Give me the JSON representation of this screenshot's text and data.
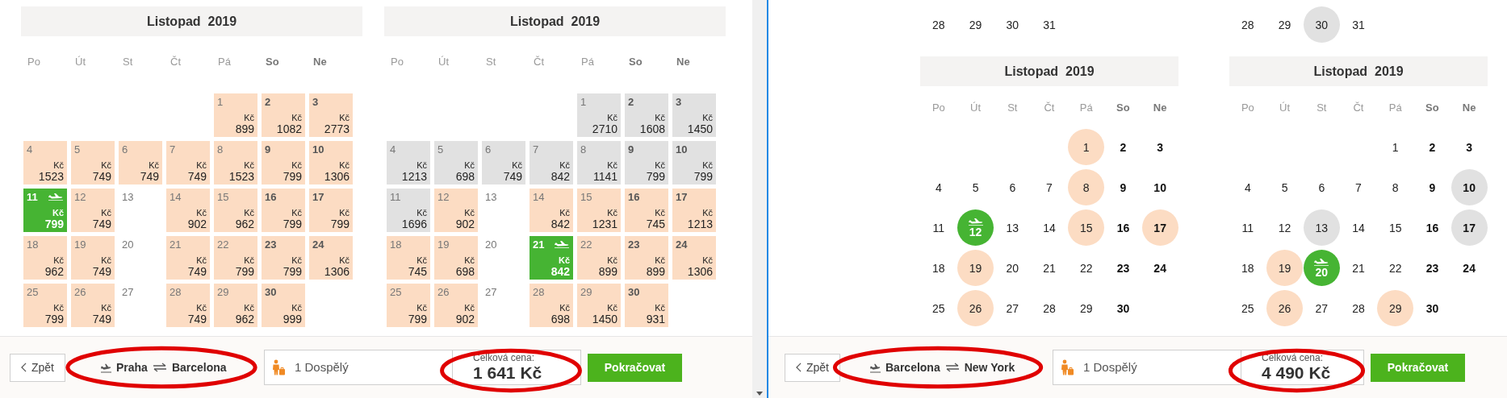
{
  "panels": [
    {
      "calendars": [
        {
          "title": "Listopad  2019",
          "weekdays": [
            {
              "label": "Po",
              "weekend": false
            },
            {
              "label": "Út",
              "weekend": false
            },
            {
              "label": "St",
              "weekend": false
            },
            {
              "label": "Čt",
              "weekend": false
            },
            {
              "label": "Pá",
              "weekend": false
            },
            {
              "label": "So",
              "weekend": true
            },
            {
              "label": "Ne",
              "weekend": true
            }
          ],
          "weeks": [
            [
              {
                "kind": "empty"
              },
              {
                "kind": "empty"
              },
              {
                "kind": "empty"
              },
              {
                "kind": "empty"
              },
              {
                "day": "1",
                "kind": "offer",
                "selected": false,
                "currency": "Kč",
                "price": "899"
              },
              {
                "day": "2",
                "kind": "offer",
                "selected": false,
                "currency": "Kč",
                "price": "1082"
              },
              {
                "day": "3",
                "kind": "offer",
                "selected": false,
                "currency": "Kč",
                "price": "2773"
              }
            ],
            [
              {
                "day": "4",
                "kind": "offer",
                "selected": false,
                "currency": "Kč",
                "price": "1523"
              },
              {
                "day": "5",
                "kind": "offer",
                "selected": false,
                "currency": "Kč",
                "price": "749"
              },
              {
                "day": "6",
                "kind": "offer",
                "selected": false,
                "currency": "Kč",
                "price": "749"
              },
              {
                "day": "7",
                "kind": "offer",
                "selected": false,
                "currency": "Kč",
                "price": "749"
              },
              {
                "day": "8",
                "kind": "offer",
                "selected": false,
                "currency": "Kč",
                "price": "1523"
              },
              {
                "day": "9",
                "kind": "offer",
                "selected": false,
                "currency": "Kč",
                "price": "799"
              },
              {
                "day": "10",
                "kind": "offer",
                "selected": false,
                "currency": "Kč",
                "price": "1306"
              }
            ],
            [
              {
                "day": "11",
                "selected": true,
                "currency": "Kč",
                "price": "799"
              },
              {
                "day": "12",
                "kind": "offer",
                "selected": false,
                "currency": "Kč",
                "price": "749"
              },
              {
                "day": "13",
                "kind": "plain",
                "selected": false
              },
              {
                "day": "14",
                "kind": "offer",
                "selected": false,
                "currency": "Kč",
                "price": "902"
              },
              {
                "day": "15",
                "kind": "offer",
                "selected": false,
                "currency": "Kč",
                "price": "962"
              },
              {
                "day": "16",
                "kind": "offer",
                "selected": false,
                "currency": "Kč",
                "price": "799"
              },
              {
                "day": "17",
                "kind": "offer",
                "selected": false,
                "currency": "Kč",
                "price": "799"
              }
            ],
            [
              {
                "day": "18",
                "kind": "offer",
                "selected": false,
                "currency": "Kč",
                "price": "962"
              },
              {
                "day": "19",
                "kind": "offer",
                "selected": false,
                "currency": "Kč",
                "price": "749"
              },
              {
                "day": "20",
                "kind": "plain",
                "selected": false
              },
              {
                "day": "21",
                "kind": "offer",
                "selected": false,
                "currency": "Kč",
                "price": "749"
              },
              {
                "day": "22",
                "kind": "offer",
                "selected": false,
                "currency": "Kč",
                "price": "799"
              },
              {
                "day": "23",
                "kind": "offer",
                "selected": false,
                "currency": "Kč",
                "price": "799"
              },
              {
                "day": "24",
                "kind": "offer",
                "selected": false,
                "currency": "Kč",
                "price": "1306"
              }
            ],
            [
              {
                "day": "25",
                "kind": "offer",
                "selected": false,
                "currency": "Kč",
                "price": "799"
              },
              {
                "day": "26",
                "kind": "offer",
                "selected": false,
                "currency": "Kč",
                "price": "749"
              },
              {
                "day": "27",
                "kind": "plain",
                "selected": false
              },
              {
                "day": "28",
                "kind": "offer",
                "selected": false,
                "currency": "Kč",
                "price": "749"
              },
              {
                "day": "29",
                "kind": "offer",
                "selected": false,
                "currency": "Kč",
                "price": "962"
              },
              {
                "day": "30",
                "kind": "offer",
                "selected": false,
                "currency": "Kč",
                "price": "999"
              }
            ]
          ]
        },
        {
          "title": "Listopad  2019",
          "weekdays": [
            {
              "label": "Po",
              "weekend": false
            },
            {
              "label": "Út",
              "weekend": false
            },
            {
              "label": "St",
              "weekend": false
            },
            {
              "label": "Čt",
              "weekend": false
            },
            {
              "label": "Pá",
              "weekend": false
            },
            {
              "label": "So",
              "weekend": true
            },
            {
              "label": "Ne",
              "weekend": true
            }
          ],
          "weeks": [
            [
              {
                "kind": "empty"
              },
              {
                "kind": "empty"
              },
              {
                "kind": "empty"
              },
              {
                "kind": "empty"
              },
              {
                "day": "1",
                "kind": "muted",
                "selected": false,
                "currency": "Kč",
                "price": "2710"
              },
              {
                "day": "2",
                "kind": "muted",
                "selected": false,
                "currency": "Kč",
                "price": "1608"
              },
              {
                "day": "3",
                "kind": "muted",
                "selected": false,
                "currency": "Kč",
                "price": "1450"
              }
            ],
            [
              {
                "day": "4",
                "kind": "muted",
                "selected": false,
                "currency": "Kč",
                "price": "1213"
              },
              {
                "day": "5",
                "kind": "muted",
                "selected": false,
                "currency": "Kč",
                "price": "698"
              },
              {
                "day": "6",
                "kind": "muted",
                "selected": false,
                "currency": "Kč",
                "price": "749"
              },
              {
                "day": "7",
                "kind": "muted",
                "selected": false,
                "currency": "Kč",
                "price": "842"
              },
              {
                "day": "8",
                "kind": "muted",
                "selected": false,
                "currency": "Kč",
                "price": "1141"
              },
              {
                "day": "9",
                "kind": "muted",
                "selected": false,
                "currency": "Kč",
                "price": "799"
              },
              {
                "day": "10",
                "kind": "muted",
                "selected": false,
                "currency": "Kč",
                "price": "799"
              }
            ],
            [
              {
                "day": "11",
                "kind": "muted",
                "selected": false,
                "currency": "Kč",
                "price": "1696"
              },
              {
                "day": "12",
                "kind": "offer",
                "selected": false,
                "currency": "Kč",
                "price": "902"
              },
              {
                "day": "13",
                "kind": "plain",
                "selected": false
              },
              {
                "day": "14",
                "kind": "offer",
                "selected": false,
                "currency": "Kč",
                "price": "842"
              },
              {
                "day": "15",
                "kind": "offer",
                "selected": false,
                "currency": "Kč",
                "price": "1231"
              },
              {
                "day": "16",
                "kind": "offer",
                "selected": false,
                "currency": "Kč",
                "price": "745"
              },
              {
                "day": "17",
                "kind": "offer",
                "selected": false,
                "currency": "Kč",
                "price": "1213"
              }
            ],
            [
              {
                "day": "18",
                "kind": "offer",
                "selected": false,
                "currency": "Kč",
                "price": "745"
              },
              {
                "day": "19",
                "kind": "offer",
                "selected": false,
                "currency": "Kč",
                "price": "698"
              },
              {
                "day": "20",
                "kind": "plain",
                "selected": false
              },
              {
                "day": "21",
                "selected": true,
                "currency": "Kč",
                "price": "842"
              },
              {
                "day": "22",
                "kind": "offer",
                "selected": false,
                "currency": "Kč",
                "price": "899"
              },
              {
                "day": "23",
                "kind": "offer",
                "selected": false,
                "currency": "Kč",
                "price": "899"
              },
              {
                "day": "24",
                "kind": "offer",
                "selected": false,
                "currency": "Kč",
                "price": "1306"
              }
            ],
            [
              {
                "day": "25",
                "kind": "offer",
                "selected": false,
                "currency": "Kč",
                "price": "799"
              },
              {
                "day": "26",
                "kind": "offer",
                "selected": false,
                "currency": "Kč",
                "price": "902"
              },
              {
                "day": "27",
                "kind": "plain",
                "selected": false
              },
              {
                "day": "28",
                "kind": "offer",
                "selected": false,
                "currency": "Kč",
                "price": "698"
              },
              {
                "day": "29",
                "kind": "offer",
                "selected": false,
                "currency": "Kč",
                "price": "1450"
              },
              {
                "day": "30",
                "kind": "offer",
                "selected": false,
                "currency": "Kč",
                "price": "931"
              }
            ]
          ]
        }
      ],
      "bar": {
        "back": {
          "label": "Zpět"
        },
        "route": {
          "from": "Praha",
          "to": "Barcelona",
          "circled": true
        },
        "passengers": {
          "value": "1 Dospělý"
        },
        "total": {
          "label": "Celková cena:",
          "amount": "1 641 Kč",
          "circled": true
        },
        "continue": {
          "label": "Pokračovat"
        }
      }
    },
    {
      "calendars": [
        {
          "previous_month_tail": [
            {
              "day": "28",
              "kind": "plain",
              "selected": false
            },
            {
              "day": "29",
              "kind": "plain",
              "selected": false
            },
            {
              "day": "30",
              "kind": "plain",
              "selected": false
            },
            {
              "day": "31",
              "kind": "plain",
              "selected": false
            }
          ],
          "title": "Listopad  2019",
          "weekdays": [
            {
              "label": "Po",
              "weekend": false
            },
            {
              "label": "Út",
              "weekend": false
            },
            {
              "label": "St",
              "weekend": false
            },
            {
              "label": "Čt",
              "weekend": false
            },
            {
              "label": "Pá",
              "weekend": false
            },
            {
              "label": "So",
              "weekend": true
            },
            {
              "label": "Ne",
              "weekend": true
            }
          ],
          "weeks": [
            [
              {
                "kind": "empty"
              },
              {
                "kind": "empty"
              },
              {
                "kind": "empty"
              },
              {
                "kind": "empty"
              },
              {
                "day": "1",
                "kind": "offer",
                "selected": false
              },
              {
                "day": "2",
                "kind": "plain",
                "selected": false
              },
              {
                "day": "3",
                "kind": "plain",
                "selected": false
              }
            ],
            [
              {
                "day": "4",
                "kind": "plain",
                "selected": false
              },
              {
                "day": "5",
                "kind": "plain",
                "selected": false
              },
              {
                "day": "6",
                "kind": "plain",
                "selected": false
              },
              {
                "day": "7",
                "kind": "plain",
                "selected": false
              },
              {
                "day": "8",
                "kind": "offer",
                "selected": false
              },
              {
                "day": "9",
                "kind": "plain",
                "selected": false
              },
              {
                "day": "10",
                "kind": "plain",
                "selected": false
              }
            ],
            [
              {
                "day": "11",
                "kind": "plain",
                "selected": false
              },
              {
                "day": "12",
                "selected": true
              },
              {
                "day": "13",
                "kind": "plain",
                "selected": false
              },
              {
                "day": "14",
                "kind": "plain",
                "selected": false
              },
              {
                "day": "15",
                "kind": "offer",
                "selected": false
              },
              {
                "day": "16",
                "kind": "plain",
                "selected": false
              },
              {
                "day": "17",
                "kind": "offer",
                "selected": false
              }
            ],
            [
              {
                "day": "18",
                "kind": "plain",
                "selected": false
              },
              {
                "day": "19",
                "kind": "offer",
                "selected": false
              },
              {
                "day": "20",
                "kind": "plain",
                "selected": false
              },
              {
                "day": "21",
                "kind": "plain",
                "selected": false
              },
              {
                "day": "22",
                "kind": "plain",
                "selected": false
              },
              {
                "day": "23",
                "kind": "plain",
                "selected": false
              },
              {
                "day": "24",
                "kind": "plain",
                "selected": false
              }
            ],
            [
              {
                "day": "25",
                "kind": "plain",
                "selected": false
              },
              {
                "day": "26",
                "kind": "offer",
                "selected": false
              },
              {
                "day": "27",
                "kind": "plain",
                "selected": false
              },
              {
                "day": "28",
                "kind": "plain",
                "selected": false
              },
              {
                "day": "29",
                "kind": "plain",
                "selected": false
              },
              {
                "day": "30",
                "kind": "plain",
                "selected": false
              }
            ]
          ]
        },
        {
          "previous_month_tail": [
            {
              "day": "28",
              "kind": "plain",
              "selected": false
            },
            {
              "day": "29",
              "kind": "plain",
              "selected": false
            },
            {
              "day": "30",
              "kind": "muted",
              "selected": false
            },
            {
              "day": "31",
              "kind": "plain",
              "selected": false
            }
          ],
          "title": "Listopad  2019",
          "weekdays": [
            {
              "label": "Po",
              "weekend": false
            },
            {
              "label": "Út",
              "weekend": false
            },
            {
              "label": "St",
              "weekend": false
            },
            {
              "label": "Čt",
              "weekend": false
            },
            {
              "label": "Pá",
              "weekend": false
            },
            {
              "label": "So",
              "weekend": true
            },
            {
              "label": "Ne",
              "weekend": true
            }
          ],
          "weeks": [
            [
              {
                "kind": "empty"
              },
              {
                "kind": "empty"
              },
              {
                "kind": "empty"
              },
              {
                "kind": "empty"
              },
              {
                "day": "1",
                "kind": "plain",
                "selected": false
              },
              {
                "day": "2",
                "kind": "plain",
                "selected": false
              },
              {
                "day": "3",
                "kind": "plain",
                "selected": false
              }
            ],
            [
              {
                "day": "4",
                "kind": "plain",
                "selected": false
              },
              {
                "day": "5",
                "kind": "plain",
                "selected": false
              },
              {
                "day": "6",
                "kind": "plain",
                "selected": false
              },
              {
                "day": "7",
                "kind": "plain",
                "selected": false
              },
              {
                "day": "8",
                "kind": "plain",
                "selected": false
              },
              {
                "day": "9",
                "kind": "plain",
                "selected": false
              },
              {
                "day": "10",
                "kind": "muted",
                "selected": false
              }
            ],
            [
              {
                "day": "11",
                "kind": "plain",
                "selected": false
              },
              {
                "day": "12",
                "kind": "plain",
                "selected": false
              },
              {
                "day": "13",
                "kind": "muted",
                "selected": false
              },
              {
                "day": "14",
                "kind": "plain",
                "selected": false
              },
              {
                "day": "15",
                "kind": "plain",
                "selected": false
              },
              {
                "day": "16",
                "kind": "plain",
                "selected": false
              },
              {
                "day": "17",
                "kind": "muted",
                "selected": false
              }
            ],
            [
              {
                "day": "18",
                "kind": "plain",
                "selected": false
              },
              {
                "day": "19",
                "kind": "offer",
                "selected": false
              },
              {
                "day": "20",
                "selected": true
              },
              {
                "day": "21",
                "kind": "plain",
                "selected": false
              },
              {
                "day": "22",
                "kind": "plain",
                "selected": false
              },
              {
                "day": "23",
                "kind": "plain",
                "selected": false
              },
              {
                "day": "24",
                "kind": "plain",
                "selected": false
              }
            ],
            [
              {
                "day": "25",
                "kind": "plain",
                "selected": false
              },
              {
                "day": "26",
                "kind": "offer",
                "selected": false
              },
              {
                "day": "27",
                "kind": "plain",
                "selected": false
              },
              {
                "day": "28",
                "kind": "plain",
                "selected": false
              },
              {
                "day": "29",
                "kind": "offer",
                "selected": false
              },
              {
                "day": "30",
                "kind": "plain",
                "selected": false
              }
            ]
          ]
        }
      ],
      "bar": {
        "back": {
          "label": "Zpět"
        },
        "route": {
          "from": "Barcelona",
          "to": "New York",
          "circled": true
        },
        "passengers": {
          "value": "1 Dospělý"
        },
        "total": {
          "label": "Celková cena:",
          "amount": "4 490 Kč",
          "circled": true
        },
        "continue": {
          "label": "Pokračovat"
        }
      }
    }
  ]
}
